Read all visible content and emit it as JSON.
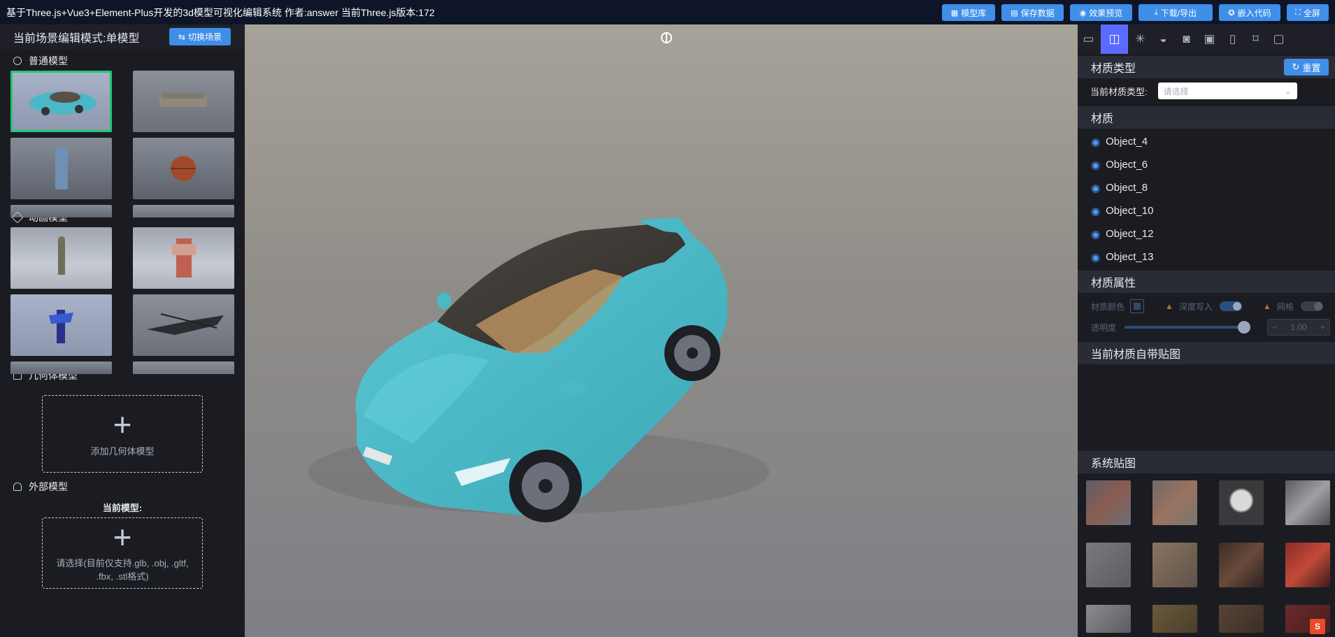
{
  "app": {
    "title": "基于Three.js+Vue3+Element-Plus开发的3d模型可视化编辑系统 作者:answer 当前Three.js版本:172"
  },
  "toolbar": {
    "buttons": [
      {
        "label": "模型库",
        "icon": "library-icon"
      },
      {
        "label": "保存数据",
        "icon": "save-icon"
      },
      {
        "label": "效果预览",
        "icon": "eye-icon"
      },
      {
        "label": "下载/导出",
        "icon": "download-icon"
      },
      {
        "label": "嵌入代码",
        "icon": "code-icon"
      },
      {
        "label": "全屏",
        "icon": "fullscreen-icon"
      }
    ]
  },
  "left": {
    "mode_title": "当前场景编辑模式:单模型",
    "switch_label": "切换场景",
    "common_title": "普通模型",
    "animation_title": "动画模型",
    "geometry_title": "几何体模型",
    "geometry_add": "添加几何体模型",
    "external_title": "外部模型",
    "current_model": "当前模型:",
    "external_hint": "请选择(目前仅支持.glb, .obj, .gltf, .fbx, .stl格式)"
  },
  "right": {
    "material_type_title": "材质类型",
    "reset_label": "重置",
    "current_material_type_label": "当前材质类型:",
    "select_placeholder": "请选择",
    "material_title": "材质",
    "materials": [
      "Object_4",
      "Object_6",
      "Object_8",
      "Object_10",
      "Object_12",
      "Object_13"
    ],
    "props_title": "材质属性",
    "color_label": "材质颜色",
    "depth_label": "深度写入",
    "wire_label": "网格",
    "opacity_label": "透明度",
    "opacity_value": "1.00",
    "opacity_level": 1.0,
    "own_maps_title": "当前材质自带贴图",
    "system_maps_title": "系统贴图"
  },
  "colors": {
    "accent": "#3f8ee8",
    "active_tab": "#5b6bff",
    "selected_outline": "#1ec677",
    "car_body": "#45b5c4"
  }
}
